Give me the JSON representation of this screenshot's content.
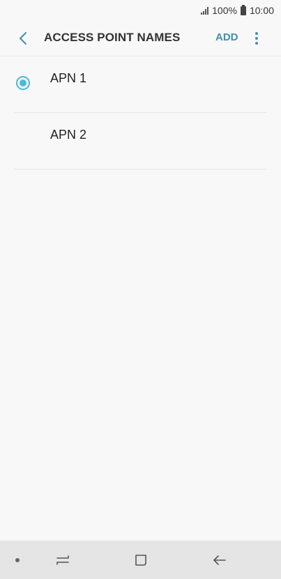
{
  "status_bar": {
    "battery_percent": "100%",
    "time": "10:00",
    "icons": [
      "signal-icon",
      "battery-icon"
    ]
  },
  "header": {
    "title": "ACCESS POINT NAMES",
    "add_label": "ADD",
    "icons": [
      "chevron-left-icon",
      "more-vertical-icon"
    ]
  },
  "apn_list": {
    "items": [
      {
        "label": "APN 1",
        "selected": true
      },
      {
        "label": "APN 2",
        "selected": false
      }
    ]
  },
  "nav_bar": {
    "icons": [
      "dot-indicator-icon",
      "recent-apps-icon",
      "home-icon",
      "back-arrow-icon"
    ]
  },
  "colors": {
    "accent": "#3f8fb3",
    "radio": "#4fb8d8",
    "background": "#f8f8f8",
    "nav_background": "#e5e5e5"
  }
}
